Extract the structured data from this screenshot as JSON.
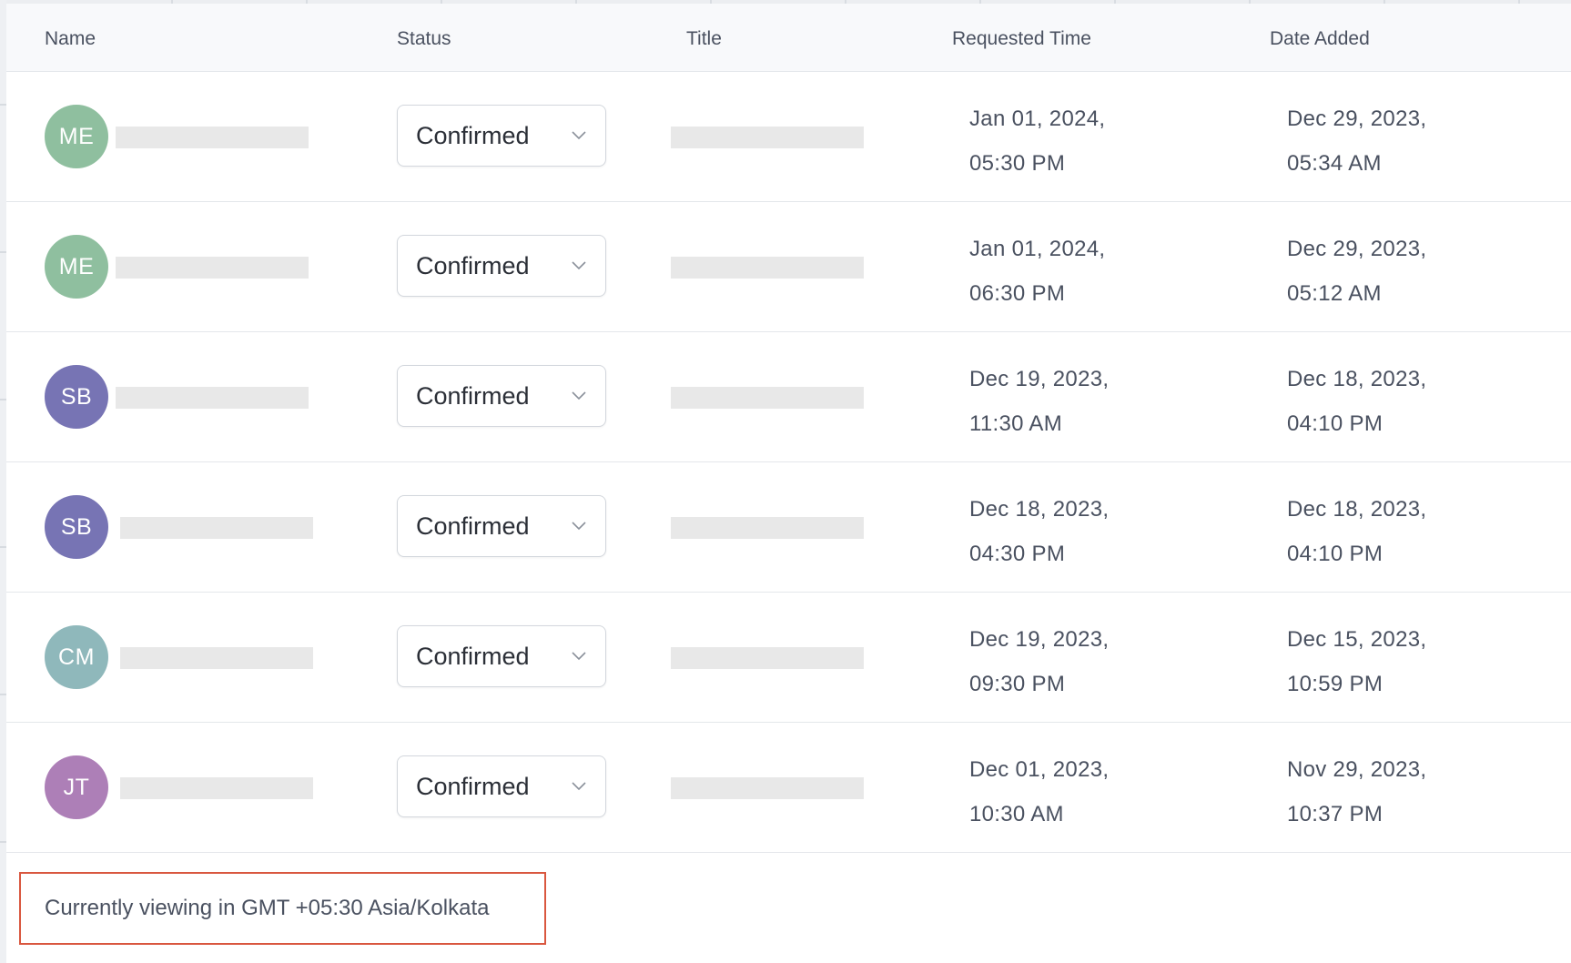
{
  "table": {
    "headers": {
      "name": "Name",
      "status": "Status",
      "title": "Title",
      "requested_time": "Requested Time",
      "date_added": "Date Added"
    },
    "rows": [
      {
        "initials": "ME",
        "avatar_color": "#8fbf9f",
        "status": "Confirmed",
        "requested_time": [
          "Jan 01, 2024,",
          "05:30 PM"
        ],
        "date_added": [
          "Dec 29, 2023,",
          "05:34 AM"
        ]
      },
      {
        "initials": "ME",
        "avatar_color": "#8fbf9f",
        "status": "Confirmed",
        "requested_time": [
          "Jan 01, 2024,",
          "06:30 PM"
        ],
        "date_added": [
          "Dec 29, 2023,",
          "05:12 AM"
        ]
      },
      {
        "initials": "SB",
        "avatar_color": "#7774b4",
        "status": "Confirmed",
        "requested_time": [
          "Dec 19, 2023,",
          "11:30 AM"
        ],
        "date_added": [
          "Dec 18, 2023,",
          "04:10 PM"
        ]
      },
      {
        "initials": "SB",
        "avatar_color": "#7774b4",
        "status": "Confirmed",
        "requested_time": [
          "Dec 18, 2023,",
          "04:30 PM"
        ],
        "date_added": [
          "Dec 18, 2023,",
          "04:10 PM"
        ]
      },
      {
        "initials": "CM",
        "avatar_color": "#8fb8bb",
        "status": "Confirmed",
        "requested_time": [
          "Dec 19, 2023,",
          "09:30 PM"
        ],
        "date_added": [
          "Dec 15, 2023,",
          "10:59 PM"
        ]
      },
      {
        "initials": "JT",
        "avatar_color": "#ad7fb7",
        "status": "Confirmed",
        "requested_time": [
          "Dec 01, 2023,",
          "10:30 AM"
        ],
        "date_added": [
          "Nov 29, 2023,",
          "10:37 PM"
        ]
      }
    ]
  },
  "footer": {
    "timezone_text": "Currently viewing in GMT +05:30 Asia/Kolkata",
    "highlight_color": "#d9573f"
  },
  "icons": {
    "status_chevron": "chevron-down-icon"
  }
}
